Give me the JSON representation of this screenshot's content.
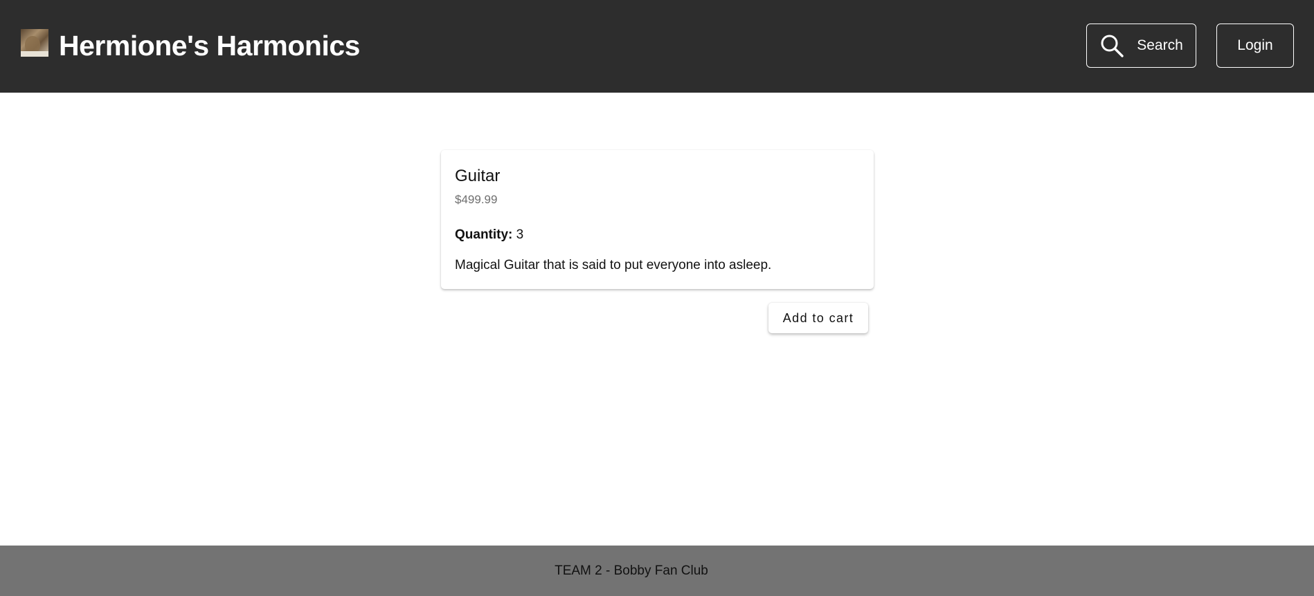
{
  "header": {
    "logo_icon": "harp-photo-thumbnail",
    "title": "Hermione's Harmonics",
    "search_icon": "search-icon",
    "search_label": "Search",
    "login_label": "Login",
    "background_color": "#2d2d2d"
  },
  "product": {
    "name": "Guitar",
    "price": "$499.99",
    "quantity_label": "Quantity:",
    "quantity_value": "3",
    "description": "Magical Guitar that is said to put everyone into asleep.",
    "add_to_cart_label": "Add to cart"
  },
  "footer": {
    "text": "TEAM 2 - Bobby Fan Club",
    "background_color": "#737373"
  }
}
